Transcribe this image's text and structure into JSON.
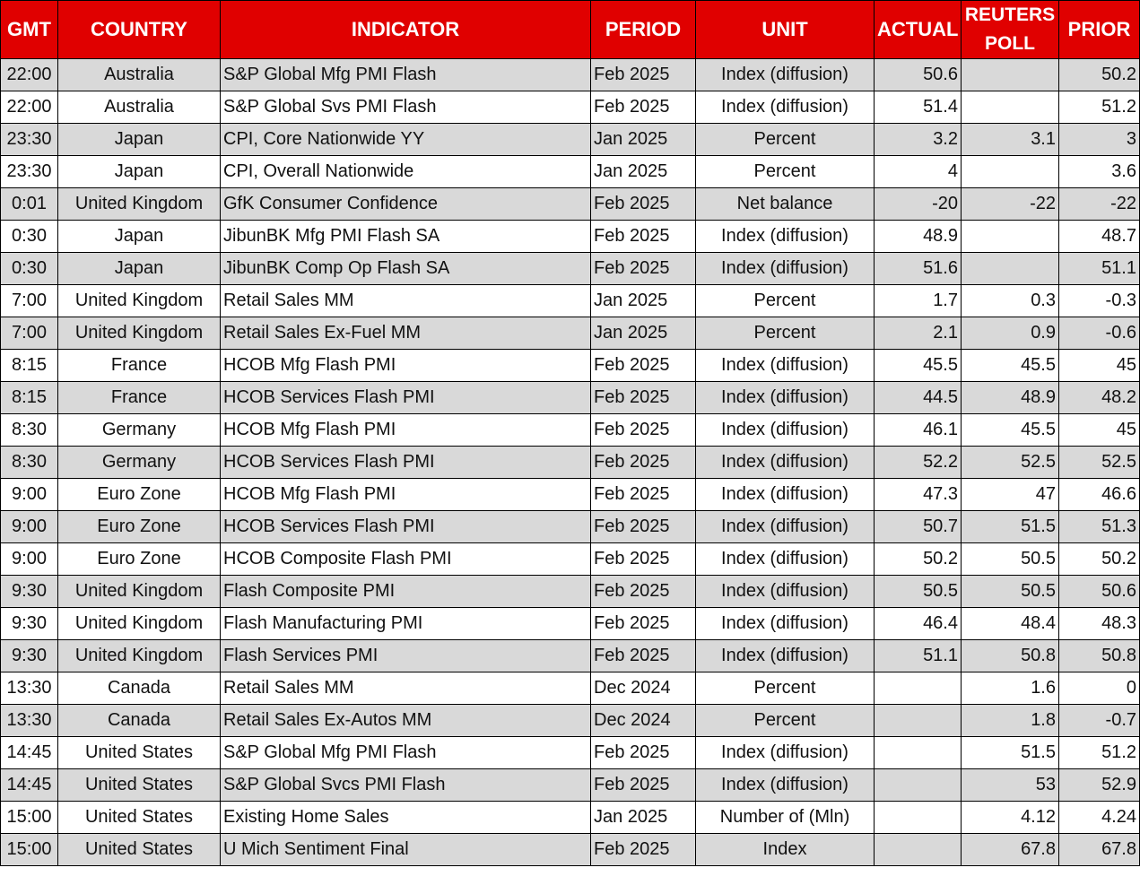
{
  "colors": {
    "header_bg": "#e00000",
    "header_text": "#ffffff",
    "shade_row": "#d9d9d9",
    "plain_row": "#ffffff"
  },
  "headers": {
    "gmt": "GMT",
    "country": "COUNTRY",
    "indicator": "INDICATOR",
    "period": "PERIOD",
    "unit": "UNIT",
    "actual": "ACTUAL",
    "poll_line1": "REUTERS",
    "poll_line2": "POLL",
    "prior": "PRIOR"
  },
  "rows": [
    {
      "gmt": "22:00",
      "country": "Australia",
      "indicator": "S&P Global Mfg PMI Flash",
      "period": "Feb 2025",
      "unit": "Index (diffusion)",
      "actual": "50.6",
      "poll": "",
      "prior": "50.2"
    },
    {
      "gmt": "22:00",
      "country": "Australia",
      "indicator": "S&P Global Svs PMI Flash",
      "period": "Feb 2025",
      "unit": "Index (diffusion)",
      "actual": "51.4",
      "poll": "",
      "prior": "51.2"
    },
    {
      "gmt": "23:30",
      "country": "Japan",
      "indicator": "CPI, Core Nationwide YY",
      "period": "Jan 2025",
      "unit": "Percent",
      "actual": "3.2",
      "poll": "3.1",
      "prior": "3"
    },
    {
      "gmt": "23:30",
      "country": "Japan",
      "indicator": "CPI, Overall Nationwide",
      "period": "Jan 2025",
      "unit": "Percent",
      "actual": "4",
      "poll": "",
      "prior": "3.6"
    },
    {
      "gmt": "0:01",
      "country": "United Kingdom",
      "indicator": "GfK Consumer Confidence",
      "period": "Feb 2025",
      "unit": "Net balance",
      "actual": "-20",
      "poll": "-22",
      "prior": "-22"
    },
    {
      "gmt": "0:30",
      "country": "Japan",
      "indicator": "JibunBK Mfg PMI Flash SA",
      "period": "Feb 2025",
      "unit": "Index (diffusion)",
      "actual": "48.9",
      "poll": "",
      "prior": "48.7"
    },
    {
      "gmt": "0:30",
      "country": "Japan",
      "indicator": "JibunBK Comp Op Flash SA",
      "period": "Feb 2025",
      "unit": "Index (diffusion)",
      "actual": "51.6",
      "poll": "",
      "prior": "51.1"
    },
    {
      "gmt": "7:00",
      "country": "United Kingdom",
      "indicator": "Retail Sales MM",
      "period": "Jan 2025",
      "unit": "Percent",
      "actual": "1.7",
      "poll": "0.3",
      "prior": "-0.3"
    },
    {
      "gmt": "7:00",
      "country": "United Kingdom",
      "indicator": "Retail Sales Ex-Fuel MM",
      "period": "Jan 2025",
      "unit": "Percent",
      "actual": "2.1",
      "poll": "0.9",
      "prior": "-0.6"
    },
    {
      "gmt": "8:15",
      "country": "France",
      "indicator": "HCOB Mfg Flash PMI",
      "period": "Feb 2025",
      "unit": "Index (diffusion)",
      "actual": "45.5",
      "poll": "45.5",
      "prior": "45"
    },
    {
      "gmt": "8:15",
      "country": "France",
      "indicator": "HCOB Services Flash PMI",
      "period": "Feb 2025",
      "unit": "Index (diffusion)",
      "actual": "44.5",
      "poll": "48.9",
      "prior": "48.2"
    },
    {
      "gmt": "8:30",
      "country": "Germany",
      "indicator": "HCOB Mfg Flash PMI",
      "period": "Feb 2025",
      "unit": "Index (diffusion)",
      "actual": "46.1",
      "poll": "45.5",
      "prior": "45"
    },
    {
      "gmt": "8:30",
      "country": "Germany",
      "indicator": "HCOB Services Flash PMI",
      "period": "Feb 2025",
      "unit": "Index (diffusion)",
      "actual": "52.2",
      "poll": "52.5",
      "prior": "52.5"
    },
    {
      "gmt": "9:00",
      "country": "Euro Zone",
      "indicator": "HCOB Mfg Flash PMI",
      "period": "Feb 2025",
      "unit": "Index (diffusion)",
      "actual": "47.3",
      "poll": "47",
      "prior": "46.6"
    },
    {
      "gmt": "9:00",
      "country": "Euro Zone",
      "indicator": "HCOB Services Flash PMI",
      "period": "Feb 2025",
      "unit": "Index (diffusion)",
      "actual": "50.7",
      "poll": "51.5",
      "prior": "51.3"
    },
    {
      "gmt": "9:00",
      "country": "Euro Zone",
      "indicator": "HCOB Composite Flash PMI",
      "period": "Feb 2025",
      "unit": "Index (diffusion)",
      "actual": "50.2",
      "poll": "50.5",
      "prior": "50.2"
    },
    {
      "gmt": "9:30",
      "country": "United Kingdom",
      "indicator": "Flash Composite PMI",
      "period": "Feb 2025",
      "unit": "Index (diffusion)",
      "actual": "50.5",
      "poll": "50.5",
      "prior": "50.6"
    },
    {
      "gmt": "9:30",
      "country": "United Kingdom",
      "indicator": "Flash Manufacturing PMI",
      "period": "Feb 2025",
      "unit": "Index (diffusion)",
      "actual": "46.4",
      "poll": "48.4",
      "prior": "48.3"
    },
    {
      "gmt": "9:30",
      "country": "United Kingdom",
      "indicator": "Flash Services PMI",
      "period": "Feb 2025",
      "unit": "Index (diffusion)",
      "actual": "51.1",
      "poll": "50.8",
      "prior": "50.8"
    },
    {
      "gmt": "13:30",
      "country": "Canada",
      "indicator": "Retail Sales MM",
      "period": "Dec 2024",
      "unit": "Percent",
      "actual": "",
      "poll": "1.6",
      "prior": "0"
    },
    {
      "gmt": "13:30",
      "country": "Canada",
      "indicator": "Retail Sales Ex-Autos MM",
      "period": "Dec 2024",
      "unit": "Percent",
      "actual": "",
      "poll": "1.8",
      "prior": "-0.7"
    },
    {
      "gmt": "14:45",
      "country": "United States",
      "indicator": "S&P Global Mfg PMI Flash",
      "period": "Feb 2025",
      "unit": "Index (diffusion)",
      "actual": "",
      "poll": "51.5",
      "prior": "51.2"
    },
    {
      "gmt": "14:45",
      "country": "United States",
      "indicator": "S&P Global Svcs PMI Flash",
      "period": "Feb 2025",
      "unit": "Index (diffusion)",
      "actual": "",
      "poll": "53",
      "prior": "52.9"
    },
    {
      "gmt": "15:00",
      "country": "United States",
      "indicator": "Existing Home Sales",
      "period": "Jan 2025",
      "unit": "Number of (Mln)",
      "actual": "",
      "poll": "4.12",
      "prior": "4.24"
    },
    {
      "gmt": "15:00",
      "country": "United States",
      "indicator": "U Mich Sentiment Final",
      "period": "Feb 2025",
      "unit": "Index",
      "actual": "",
      "poll": "67.8",
      "prior": "67.8"
    }
  ]
}
